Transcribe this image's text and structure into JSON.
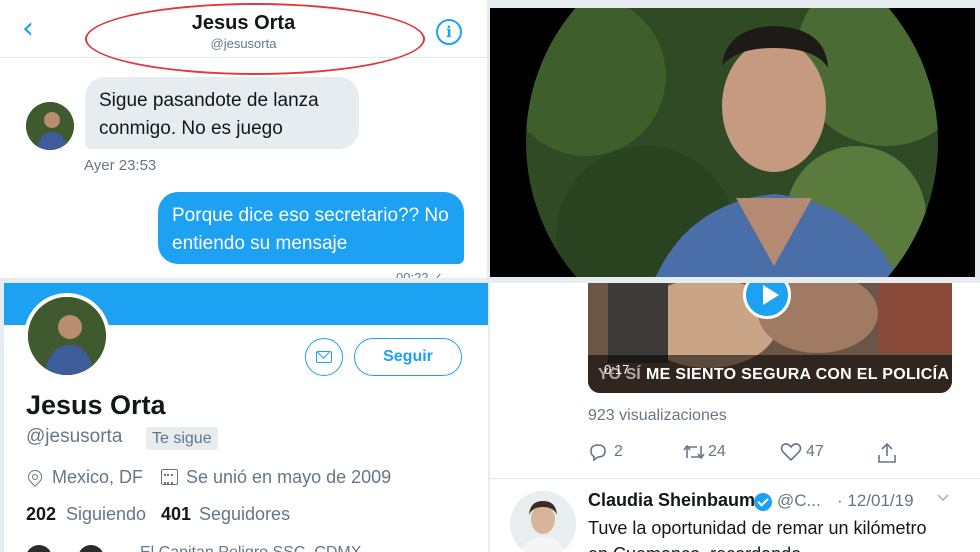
{
  "dm": {
    "name": "Jesus Orta",
    "handle": "@jesusorta",
    "back_icon": "chevron-left-icon",
    "info_icon": "info-icon",
    "incoming_message": "Sigue pasandote de lanza conmigo. No es juego",
    "incoming_time": "Ayer 23:53",
    "outgoing_message": "Porque dice eso secretario?? No entiendo su mensaje",
    "outgoing_time_partial": "00:22 ✓",
    "highlight_color": "#e0383b"
  },
  "profile": {
    "name": "Jesus Orta",
    "handle": "@jesusorta",
    "follows_you": "Te sigue",
    "follow_label": "Seguir",
    "location": "Mexico, DF",
    "joined": "Se unió en mayo de 2009",
    "following_count": "202",
    "following_label": "Siguiendo",
    "followers_count": "401",
    "followers_label": "Seguidores",
    "followed_by": "El Capitan Peligro SSC_CDMX",
    "accent_color": "#1da1f2"
  },
  "tweet": {
    "video_overlay_text": "ME SIENTO SEGURA CON EL POLICÍA",
    "video_overlay_pre": "YO SÍ",
    "video_duration": "0:17",
    "views": "923 visualizaciones",
    "replies": "2",
    "retweets": "24",
    "likes": "47",
    "author": "Claudia Sheinbaum",
    "author_handle": "@C...",
    "date": "· 12/01/19",
    "text": "Tuve la oportunidad de remar un kilómetro en Cuemanco, recordando"
  }
}
